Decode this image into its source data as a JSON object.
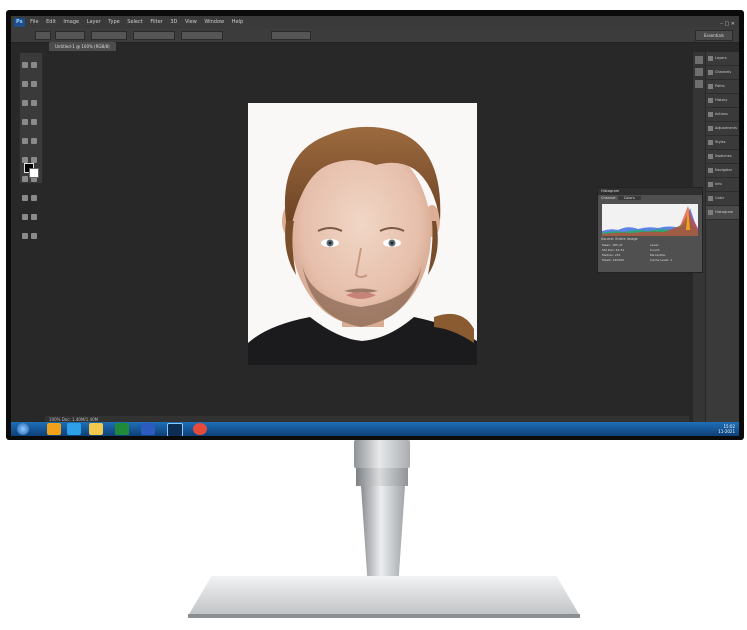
{
  "window": {
    "app_badge": "Ps",
    "menu": [
      "File",
      "Edit",
      "Image",
      "Layer",
      "Type",
      "Select",
      "Filter",
      "3D",
      "View",
      "Window",
      "Help"
    ],
    "controls": [
      "–",
      "□",
      "✕"
    ],
    "workspace": "Essentials"
  },
  "document_tab": "Untitled-1 @ 100% (RGB/8)",
  "status_bar": "100%    Doc: 1.40M/1.40M",
  "right_panels": [
    "Layers",
    "Channels",
    "Paths",
    "History",
    "Actions",
    "Adjustments",
    "Styles",
    "Swatches",
    "Navigator",
    "Info",
    "Color",
    "Histogram"
  ],
  "histogram": {
    "title": "Histogram",
    "channel_label": "Channel:",
    "channel_value": "Colors",
    "source_label": "Source:",
    "source_value": "Entire Image",
    "stats_left": [
      "Mean: 185.47",
      "Std Dev: 61.51",
      "Median: 201",
      "Pixels: 142500"
    ],
    "stats_right": [
      "Level:",
      "Count:",
      "Percentile:",
      "Cache Level: 1"
    ]
  },
  "taskbar": {
    "time": "15:02",
    "date": "11-2021",
    "apps": [
      "explorer",
      "vlc",
      "ie",
      "folder",
      "excel",
      "word",
      "photoshop",
      "chrome"
    ]
  }
}
